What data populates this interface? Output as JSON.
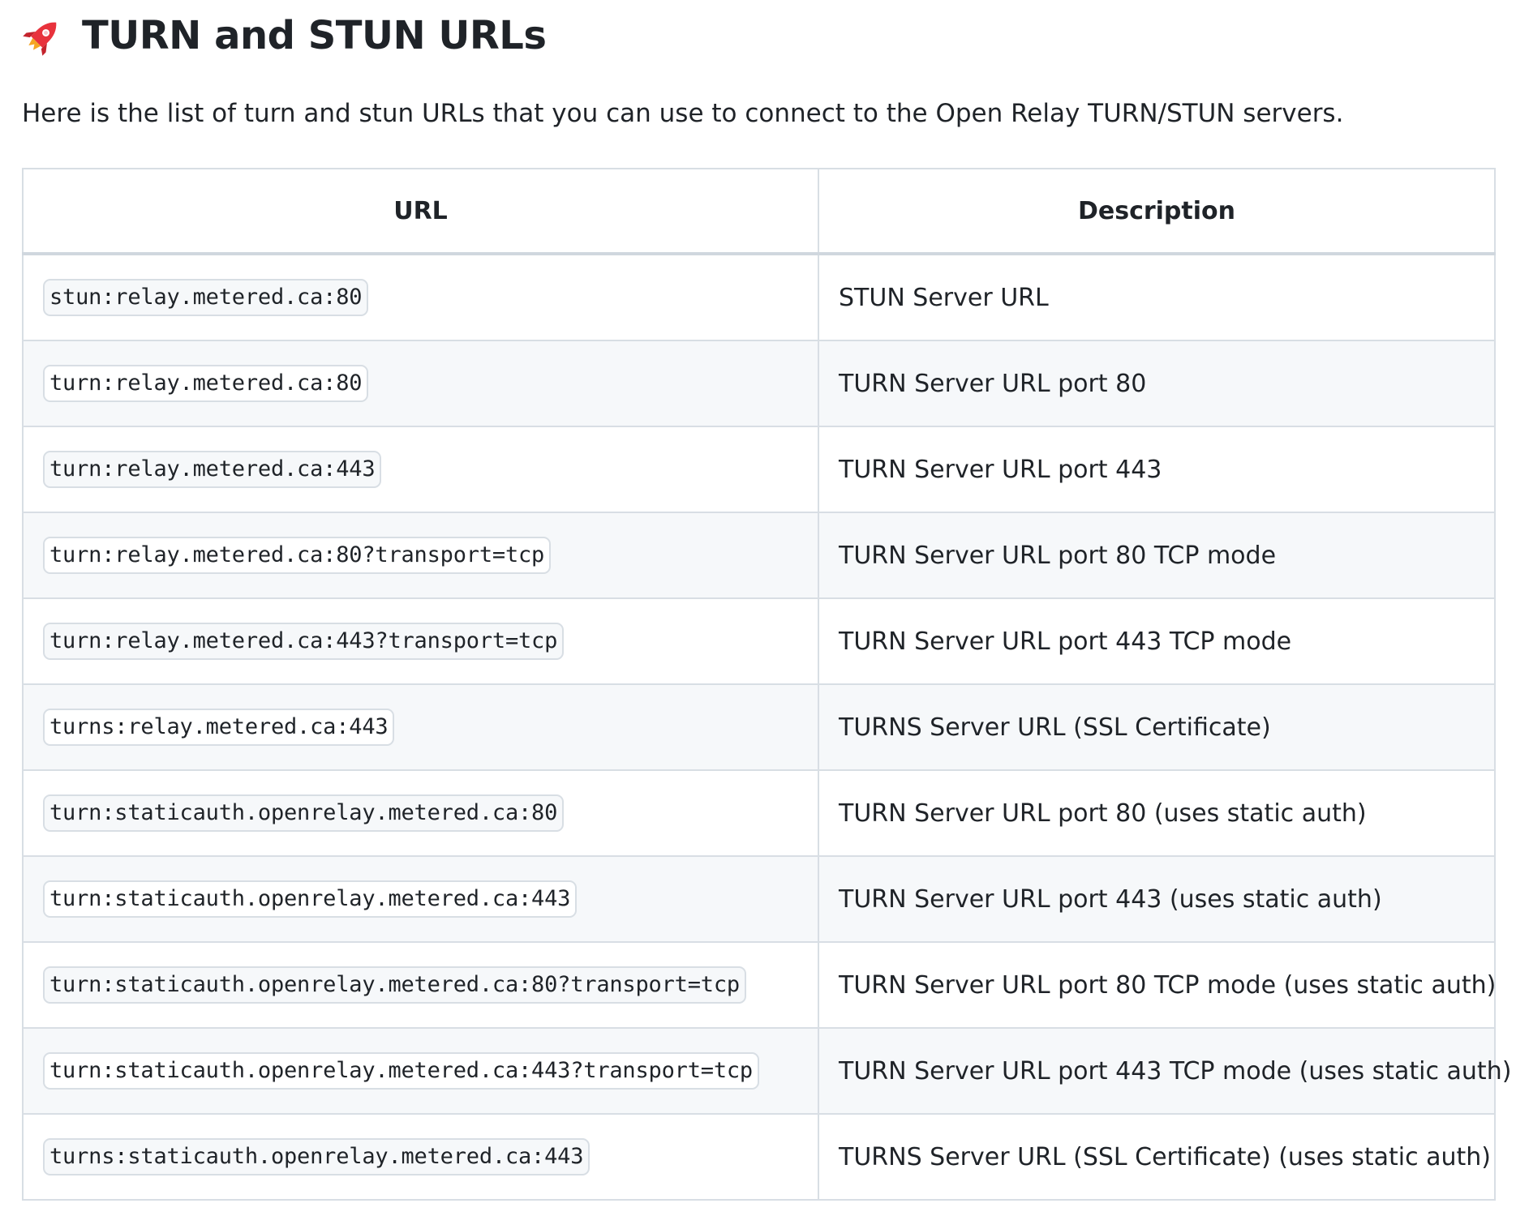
{
  "heading": {
    "icon": "rocket-icon",
    "title": "TURN and STUN URLs"
  },
  "intro": "Here is the list of turn and stun URLs that you can use to connect to the Open Relay TURN/STUN servers.",
  "table": {
    "headers": {
      "url": "URL",
      "description": "Description"
    },
    "rows": [
      {
        "url": "stun:relay.metered.ca:80",
        "description": "STUN Server URL"
      },
      {
        "url": "turn:relay.metered.ca:80",
        "description": "TURN Server URL port 80"
      },
      {
        "url": "turn:relay.metered.ca:443",
        "description": "TURN Server URL port 443"
      },
      {
        "url": "turn:relay.metered.ca:80?transport=tcp",
        "description": "TURN Server URL port 80 TCP mode"
      },
      {
        "url": "turn:relay.metered.ca:443?transport=tcp",
        "description": "TURN Server URL port 443 TCP mode"
      },
      {
        "url": "turns:relay.metered.ca:443",
        "description": "TURNS Server URL (SSL Certificate)"
      },
      {
        "url": "turn:staticauth.openrelay.metered.ca:80",
        "description": "TURN Server URL port 80 (uses static auth)"
      },
      {
        "url": "turn:staticauth.openrelay.metered.ca:443",
        "description": "TURN Server URL port 443 (uses static auth)"
      },
      {
        "url": "turn:staticauth.openrelay.metered.ca:80?transport=tcp",
        "description": "TURN Server URL port 80 TCP mode (uses static auth)"
      },
      {
        "url": "turn:staticauth.openrelay.metered.ca:443?transport=tcp",
        "description": "TURN Server URL port 443 TCP mode (uses static auth)"
      },
      {
        "url": "turns:staticauth.openrelay.metered.ca:443",
        "description": "TURNS Server URL (SSL Certificate) (uses static auth)"
      }
    ]
  },
  "colors": {
    "rocket_red": "#e8323c",
    "border": "#d8dee4",
    "stripe": "#f6f8fa",
    "text": "#1f2328"
  }
}
